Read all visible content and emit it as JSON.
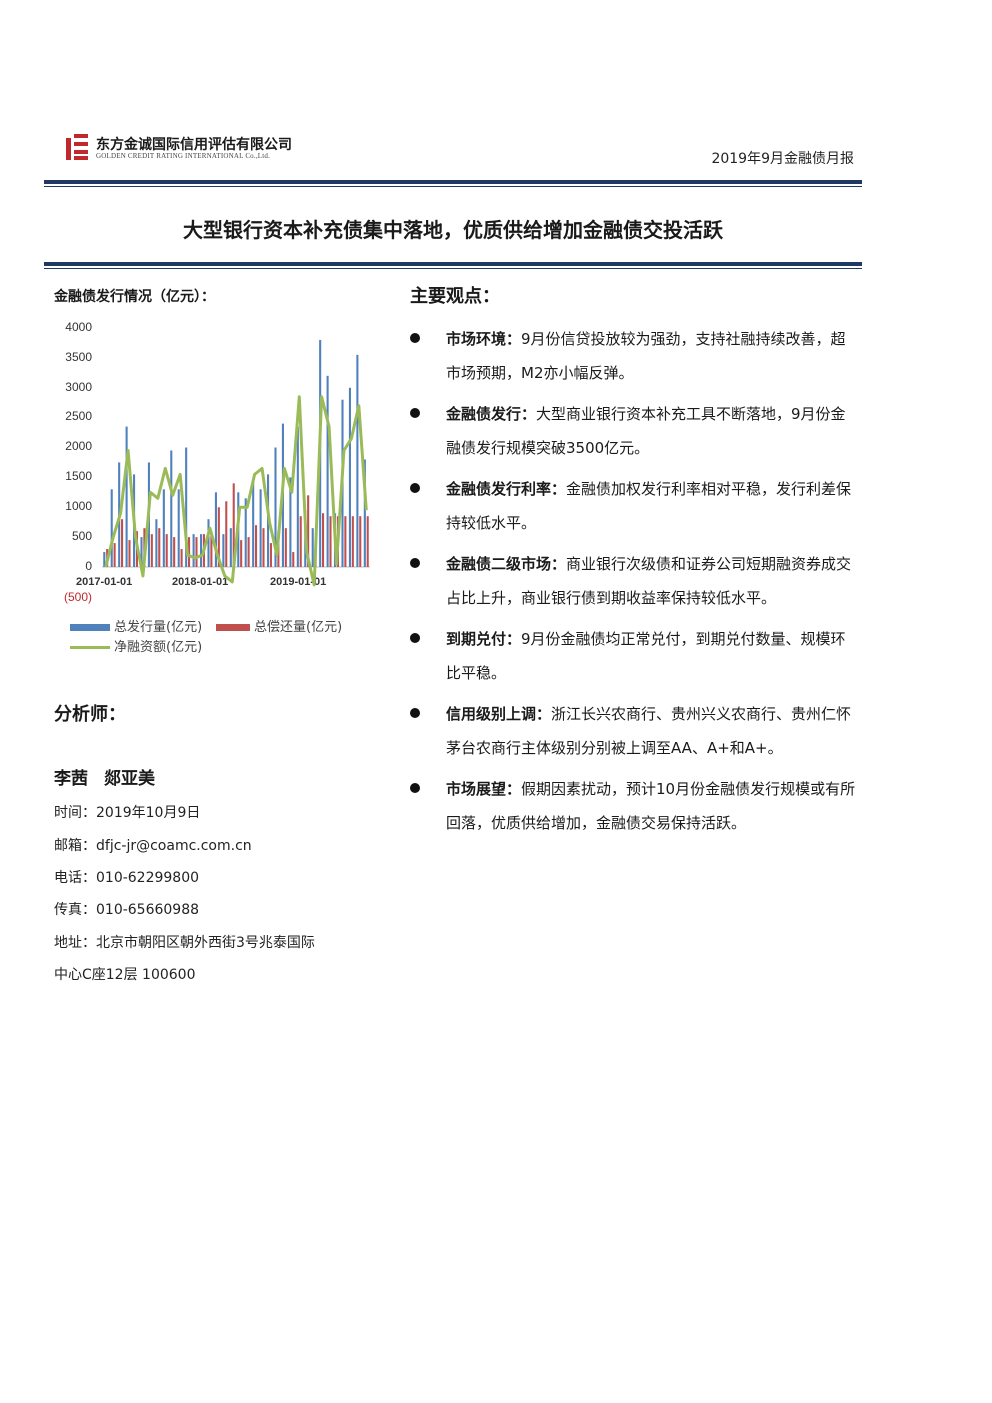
{
  "header": {
    "company_cn": "东方金诚国际信用评估有限公司",
    "company_en": "GOLDEN CREDIT RATING INTERNATIONAL Co.,Ltd.",
    "report_name": "2019年9月金融债月报"
  },
  "title": "大型银行资本补充债集中落地，优质供给增加金融债交投活跃",
  "chart_section": {
    "title": "金融债发行情况（亿元）："
  },
  "chart_data": {
    "type": "bar",
    "x_tick_labels": [
      "2017-01-01",
      "2018-01-01",
      "2019-01-01"
    ],
    "y_tick_labels": [
      "4000",
      "3500",
      "3000",
      "2500",
      "2000",
      "1500",
      "1000",
      "500",
      "0",
      "(500)"
    ],
    "ylim": [
      -500,
      4000
    ],
    "series": [
      {
        "name": "总发行量(亿元)",
        "type": "bar",
        "color": "#4f81bd",
        "values": [
          250,
          1300,
          1750,
          2350,
          1550,
          500,
          1750,
          800,
          1300,
          1950,
          1300,
          2000,
          550,
          550,
          800,
          1250,
          550,
          650,
          1250,
          1150,
          1450,
          1300,
          1550,
          2000,
          2400,
          1500,
          2350,
          950,
          650,
          3800,
          3200,
          900,
          2800,
          3000,
          3550,
          1800
        ]
      },
      {
        "name": "总偿还量(亿元)",
        "type": "bar",
        "color": "#c0504d",
        "values": [
          300,
          400,
          800,
          450,
          600,
          650,
          550,
          650,
          550,
          500,
          300,
          500,
          500,
          550,
          550,
          1000,
          1100,
          1400,
          450,
          500,
          700,
          650,
          400,
          600,
          650,
          250,
          850,
          1200,
          400,
          900,
          850,
          850,
          850,
          850,
          850,
          850
        ]
      },
      {
        "name": "净融资额(亿元)",
        "type": "line",
        "color": "#9bbb59",
        "values": [
          0,
          500,
          900,
          1950,
          500,
          -150,
          1250,
          1150,
          1650,
          1200,
          1550,
          200,
          150,
          200,
          650,
          200,
          -150,
          -250,
          1000,
          1000,
          1550,
          1650,
          750,
          200,
          1650,
          1250,
          2850,
          250,
          -300,
          2850,
          2350,
          50,
          1950,
          2150,
          2700,
          950
        ]
      }
    ]
  },
  "analysts_section": {
    "heading": "分析师：",
    "names": [
      "李茜",
      "郯亚美"
    ],
    "contacts": [
      "时间：2019年10月9日",
      "邮箱：dfjc-jr@coamc.com.cn",
      "电话：010-62299800",
      "传真：010-65660988",
      "地址：北京市朝阳区朝外西街3号兆泰国际",
      "中心C座12层 100600"
    ]
  },
  "key_points": {
    "heading": "主要观点：",
    "items": [
      {
        "label": "市场环境：",
        "text": "9月份信贷投放较为强劲，支持社融持续改善，超市场预期，M2亦小幅反弹。"
      },
      {
        "label": "金融债发行：",
        "text": "大型商业银行资本补充工具不断落地，9月份金融债发行规模突破3500亿元。"
      },
      {
        "label": "金融债发行利率：",
        "text": "金融债加权发行利率相对平稳，发行利差保持较低水平。"
      },
      {
        "label": "金融债二级市场：",
        "text": "商业银行次级债和证券公司短期融资券成交占比上升，商业银行债到期收益率保持较低水平。"
      },
      {
        "label": "到期兑付：",
        "text": "9月份金融债均正常兑付，到期兑付数量、规模环比平稳。"
      },
      {
        "label": "信用级别上调：",
        "text": "浙江长兴农商行、贵州兴义农商行、贵州仁怀茅台农商行主体级别分别被上调至AA、A+和A+。"
      },
      {
        "label": "市场展望：",
        "text": "假期因素扰动，预计10月份金融债发行规模或有所回落，优质供给增加，金融债交易保持活跃。"
      }
    ]
  }
}
